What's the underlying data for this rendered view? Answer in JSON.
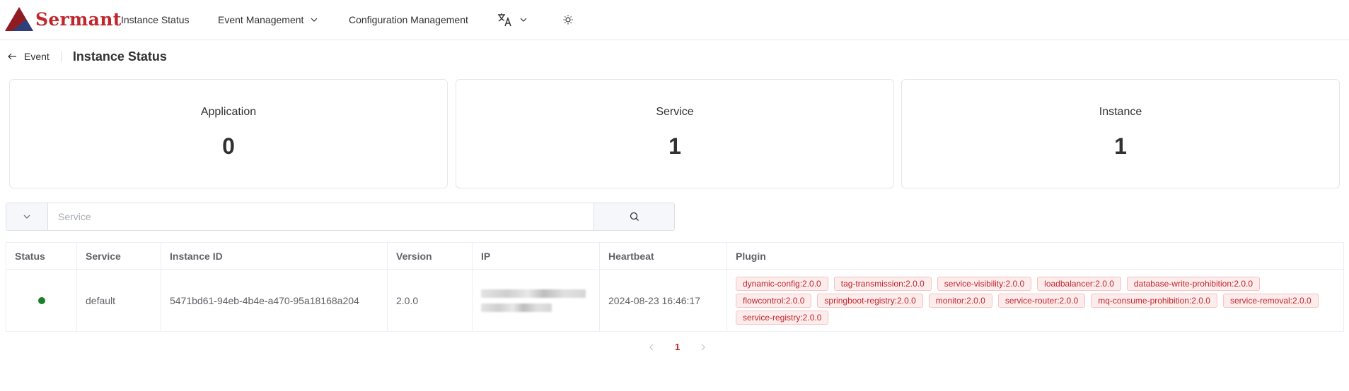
{
  "brand": {
    "name": "Sermant",
    "accent": "#c0262c"
  },
  "nav": {
    "instance_status": "Instance Status",
    "event_management": "Event Management",
    "configuration_management": "Configuration Management",
    "language_icon": "translate-icon",
    "theme_icon": "sun-icon"
  },
  "breadcrumb": {
    "back_label": "Event",
    "title": "Instance Status"
  },
  "stats": {
    "application": {
      "label": "Application",
      "value": "0"
    },
    "service": {
      "label": "Service",
      "value": "1"
    },
    "instance": {
      "label": "Instance",
      "value": "1"
    }
  },
  "search": {
    "placeholder": "Service",
    "value": ""
  },
  "table": {
    "headers": {
      "status": "Status",
      "service": "Service",
      "instance_id": "Instance ID",
      "version": "Version",
      "ip": "IP",
      "heartbeat": "Heartbeat",
      "plugin": "Plugin"
    },
    "rows": [
      {
        "status_color": "#1a7f26",
        "service": "default",
        "instance_id": "5471bd61-94eb-4b4e-a470-95a18168a204",
        "version": "2.0.0",
        "heartbeat": "2024-08-23 16:46:17",
        "plugins": [
          "dynamic-config:2.0.0",
          "tag-transmission:2.0.0",
          "service-visibility:2.0.0",
          "loadbalancer:2.0.0",
          "database-write-prohibition:2.0.0",
          "flowcontrol:2.0.0",
          "springboot-registry:2.0.0",
          "monitor:2.0.0",
          "service-router:2.0.0",
          "mq-consume-prohibition:2.0.0",
          "service-removal:2.0.0",
          "service-registry:2.0.0"
        ]
      }
    ]
  },
  "pagination": {
    "current_page": "1"
  }
}
